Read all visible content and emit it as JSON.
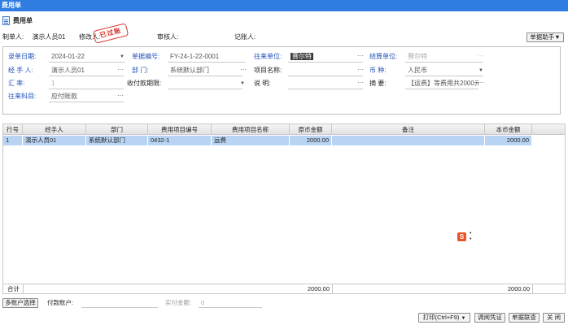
{
  "window": {
    "title": "费用单"
  },
  "doc": {
    "title": "费用单"
  },
  "meta": {
    "creator_label": "制单人:",
    "creator_value": "演示人员01",
    "modifier_label": "修改人:",
    "reviewer_label": "审核人:",
    "poster_label": "记账人:"
  },
  "stamp": {
    "text": "已过账",
    "color": "#d9342b"
  },
  "helper_button": {
    "label": "单据助手▼"
  },
  "form": {
    "entry_date": {
      "label": "录单日期:",
      "value": "2024-01-22"
    },
    "bill_no": {
      "label": "单据编号:",
      "value": "FY-24-1-22-0001"
    },
    "partner": {
      "label": "往来单位:",
      "value": "赛尔特"
    },
    "settle_unit": {
      "label": "结算单位:",
      "value": "赛尔特"
    },
    "handler": {
      "label": "经 手 人:",
      "value": "演示人员01"
    },
    "department": {
      "label": "部    门:",
      "value": "系统默认部门"
    },
    "item_name": {
      "label": "项目名称:",
      "value": ""
    },
    "currency": {
      "label": "币    种:",
      "value": "人民币"
    },
    "rate": {
      "label": "汇    率:",
      "value": "1"
    },
    "pay_due": {
      "label": "收付款期限:",
      "value": ""
    },
    "memo": {
      "label": "说    明:",
      "value": ""
    },
    "summary": {
      "label": "摘    要:",
      "value": "【运费】等费用共2000元"
    },
    "account": {
      "label": "往来科目:",
      "value": "应付账款"
    }
  },
  "grid": {
    "columns": [
      "行号",
      "经手人",
      "部门",
      "费用项目编号",
      "费用项目名称",
      "原币金额",
      "备注",
      "本币金额"
    ],
    "rows": [
      {
        "no": "1",
        "handler": "演示人员01",
        "dept": "系统默认部门",
        "item_code": "0432-1",
        "item_name": "运费",
        "amount": "2000.00",
        "remark": "",
        "local_amount": "2000.00"
      }
    ],
    "footer": {
      "label": "合计",
      "amount": "2000.00",
      "local_amount": "2000.00"
    }
  },
  "bottom": {
    "multi_account_button": "多账户选择",
    "pay_account_label": "付款账户:",
    "pay_account_value": "",
    "actual_amount_label": "实付金额:",
    "actual_amount_value": "0",
    "print_button": "打印(Ctrl+F9)",
    "voucher_button": "调阅凭证",
    "joint_button": "单据联查",
    "close_button": "关 闭"
  },
  "colors": {
    "title_bar": "#2f7de1",
    "selected_row": "#b9d4f3",
    "label_blue": "#1f4fb8"
  }
}
